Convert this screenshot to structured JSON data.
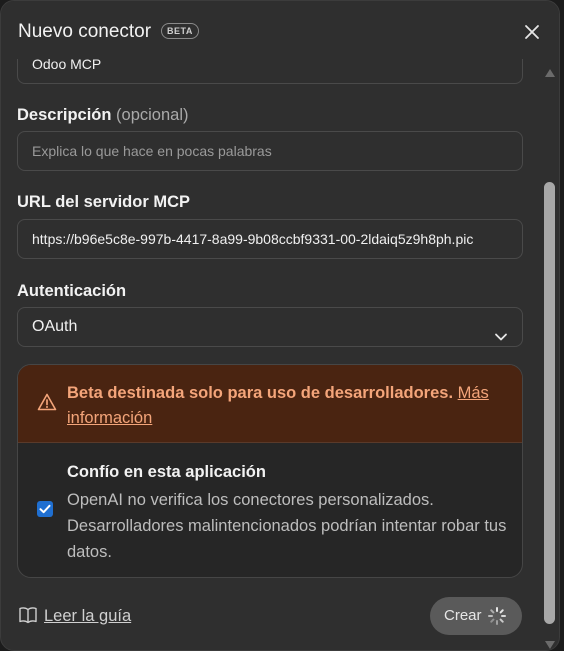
{
  "dialog": {
    "title": "Nuevo conector",
    "badge": "BETA"
  },
  "form": {
    "name_value": "Odoo MCP",
    "description_label": "Descripción",
    "description_optional": "(opcional)",
    "description_placeholder": "Explica lo que hace en pocas palabras",
    "url_label": "URL del servidor MCP",
    "url_value": "https://b96e5c8e-997b-4417-8a99-9b08ccbf9331-00-2ldaiq5z9h8ph.pic",
    "auth_label": "Autenticación",
    "auth_value": "OAuth"
  },
  "warning": {
    "text": "Beta destinada solo para uso de desarrolladores.",
    "link_line1": "Más",
    "link_line2": "información",
    "trust_title": "Confío en esta aplicación",
    "trust_desc": "OpenAI no verifica los conectores personalizados. Desarrolladores malintencionados podrían intentar robar tus datos.",
    "trust_checked": true
  },
  "footer": {
    "guide_link": "Leer la guía",
    "create_label": "Crear"
  },
  "colors": {
    "accent": "#1f6fd1",
    "warning_bg": "#4a2411",
    "warning_text": "#f4a57a"
  },
  "icons": [
    "close-icon",
    "warning-icon",
    "check-icon",
    "book-icon",
    "spinner-icon",
    "chevron-down-icon"
  ]
}
